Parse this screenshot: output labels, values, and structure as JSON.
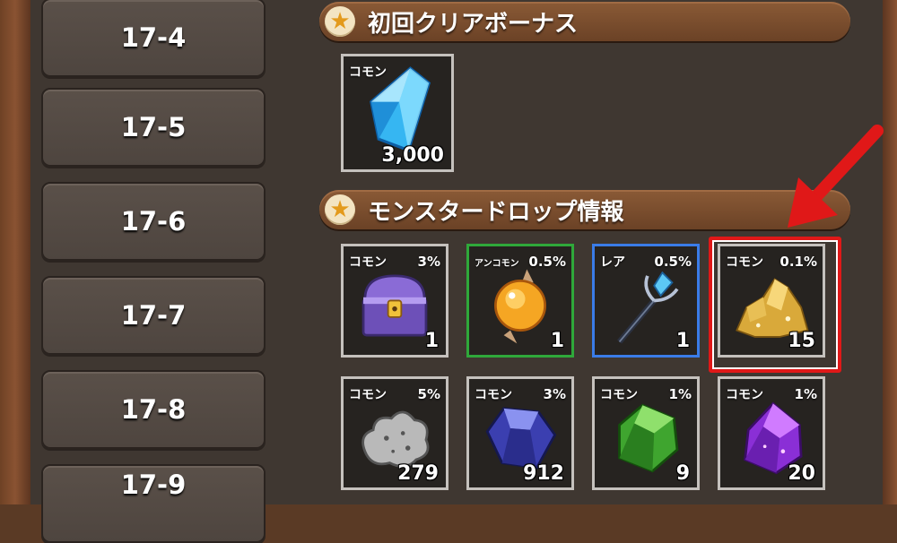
{
  "stages": [
    {
      "label": "17-4"
    },
    {
      "label": "17-5"
    },
    {
      "label": "17-6"
    },
    {
      "label": "17-7"
    },
    {
      "label": "17-8"
    },
    {
      "label": "17-9"
    }
  ],
  "first_clear": {
    "title": "初回クリアボーナス",
    "items": [
      {
        "rarity": "コモン",
        "qty": "3,000",
        "icon": "blue-crystal-icon"
      }
    ]
  },
  "monster_drop": {
    "title": "モンスタードロップ情報",
    "items": [
      {
        "rarity": "コモン",
        "rate": "3%",
        "qty": "1",
        "icon": "treasure-chest-icon"
      },
      {
        "rarity": "アンコモン",
        "rate": "0.5%",
        "qty": "1",
        "icon": "orange-orb-pendulum-icon"
      },
      {
        "rarity": "レア",
        "rate": "0.5%",
        "qty": "1",
        "icon": "crystal-staff-icon"
      },
      {
        "rarity": "コモン",
        "rate": "0.1%",
        "qty": "15",
        "icon": "gold-ore-icon"
      },
      {
        "rarity": "コモン",
        "rate": "5%",
        "qty": "279",
        "icon": "silver-ore-icon"
      },
      {
        "rarity": "コモン",
        "rate": "3%",
        "qty": "912",
        "icon": "sapphire-icon"
      },
      {
        "rarity": "コモン",
        "rate": "1%",
        "qty": "9",
        "icon": "emerald-icon"
      },
      {
        "rarity": "コモン",
        "rate": "1%",
        "qty": "20",
        "icon": "amethyst-icon"
      }
    ]
  },
  "colors": {
    "common_border": "#c5c1bd",
    "uncommon_border": "#2fa83a",
    "rare_border": "#3a7ce8",
    "highlight": "#e01818"
  }
}
